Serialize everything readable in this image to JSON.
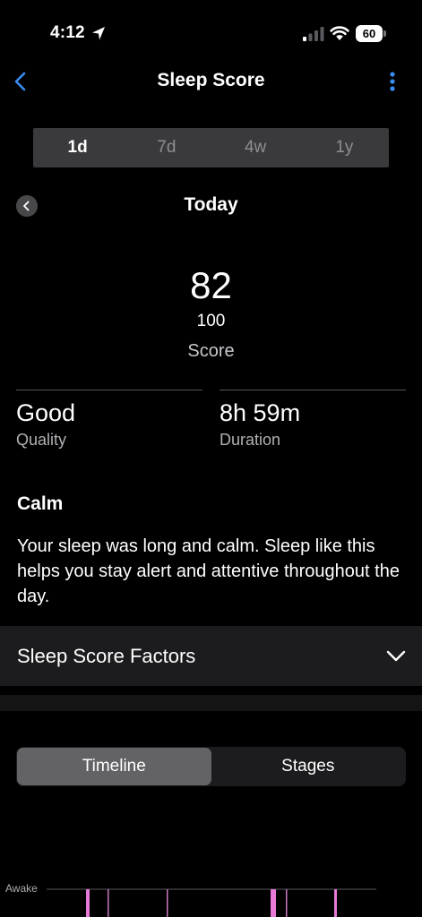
{
  "status": {
    "time": "4:12",
    "battery": "60",
    "icons": [
      "location-arrow-icon",
      "cell-signal-icon",
      "wifi-icon",
      "battery-icon"
    ]
  },
  "nav": {
    "title": "Sleep Score",
    "back_icon": "chevron-left-icon",
    "more_icon": "vertical-ellipsis-icon"
  },
  "range_tabs": [
    {
      "label": "1d",
      "active": true
    },
    {
      "label": "7d",
      "active": false
    },
    {
      "label": "4w",
      "active": false
    },
    {
      "label": "1y",
      "active": false
    }
  ],
  "date": {
    "label": "Today",
    "prev_icon": "chevron-left-circle-icon"
  },
  "score": {
    "value": "82",
    "max": "100",
    "label": "Score"
  },
  "stats": {
    "quality": {
      "value": "Good",
      "caption": "Quality"
    },
    "duration": {
      "value": "8h 59m",
      "caption": "Duration"
    }
  },
  "insight": {
    "title": "Calm",
    "body": "Your sleep was long and calm. Sleep like this helps you stay alert and attentive throughout the day."
  },
  "factors": {
    "label": "Sleep Score Factors",
    "icon": "chevron-down-icon"
  },
  "view_tabs": [
    {
      "label": "Timeline",
      "active": true
    },
    {
      "label": "Stages",
      "active": false
    }
  ],
  "timeline": {
    "row_label": "Awake",
    "awake_color": "#e879d6",
    "marker_color": "#c879c0"
  },
  "colors": {
    "accent": "#3a8df0",
    "background": "#000000"
  }
}
